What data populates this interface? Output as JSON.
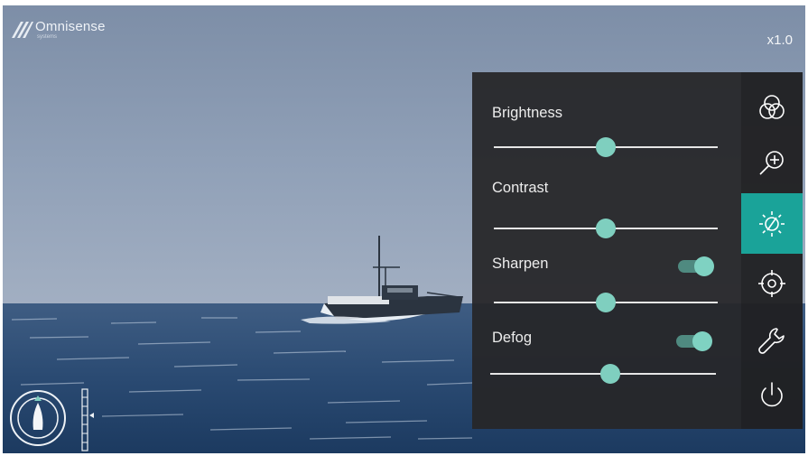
{
  "brand": {
    "name": "Omnisense",
    "sub": "systems",
    "logo_icon": "omnisense-logo-stripes-icon"
  },
  "zoom_readout": "x1.0",
  "colors": {
    "accent": "#1aa399",
    "thumb": "#7fcfbf",
    "panel": "#262628"
  },
  "controls": [
    {
      "label": "Brightness",
      "value": 0.5,
      "toggle": null
    },
    {
      "label": "Contrast",
      "value": 0.5,
      "toggle": null
    },
    {
      "label": "Sharpen",
      "value": 0.5,
      "toggle": true
    },
    {
      "label": "Defog",
      "value": 0.53,
      "toggle": true
    }
  ],
  "sidebar": [
    {
      "icon": "color-filter-icon",
      "active": false
    },
    {
      "icon": "zoom-in-icon",
      "active": false
    },
    {
      "icon": "image-adjust-icon",
      "active": true
    },
    {
      "icon": "crosshair-target-icon",
      "active": false
    },
    {
      "icon": "wrench-icon",
      "active": false
    },
    {
      "icon": "power-icon",
      "active": false
    }
  ],
  "compass_icon": "vessel-heading-compass-icon",
  "gauge_icon": "elevation-scale-icon"
}
